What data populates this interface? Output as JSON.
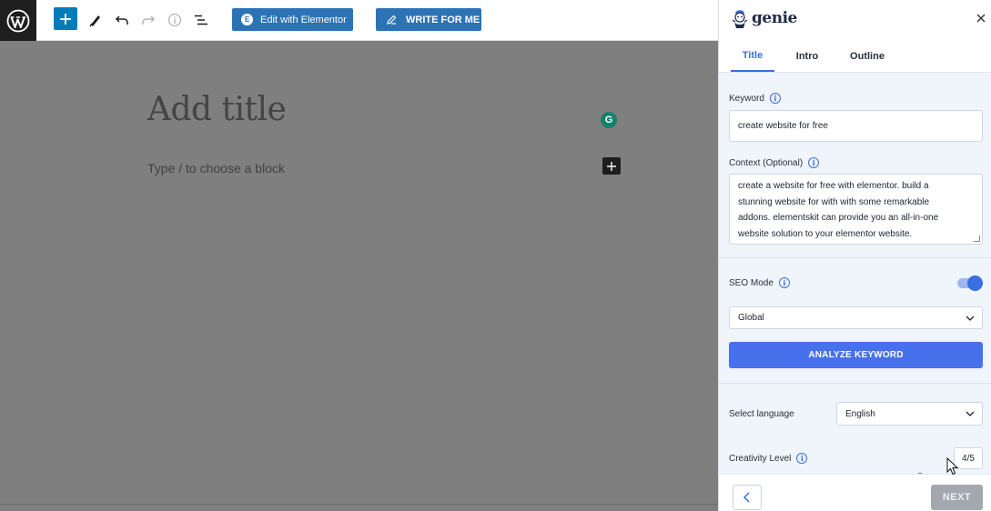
{
  "toolbar": {
    "elementor_label": "Edit with Elementor",
    "write_label": "WRITE FOR ME",
    "icons": [
      "wordpress-logo",
      "add-block-icon",
      "pen-tool-icon",
      "undo-icon",
      "redo-icon",
      "info-icon",
      "list-view-icon"
    ]
  },
  "editor": {
    "title_placeholder": "Add title",
    "block_placeholder": "Type / to choose a block"
  },
  "genie": {
    "brand": "genie",
    "tabs": [
      "Title",
      "Intro",
      "Outline"
    ],
    "active_tab": "Title",
    "keyword": {
      "label": "Keyword",
      "value": "create website for free"
    },
    "context": {
      "label": "Context (Optional)",
      "lines": [
        "create a website for free with elementor. build a",
        "stunning website for with with some remarkable",
        "addons. elementskit can provide you an all-in-one",
        "website solution to your elementor website."
      ]
    },
    "seo_mode": {
      "label": "SEO Mode",
      "enabled": true,
      "selected": "Global"
    },
    "analyze_label": "ANALYZE KEYWORD",
    "language": {
      "label": "Select language",
      "selected": "English"
    },
    "creativity": {
      "label": "Creativity Level",
      "value_text": "4/5"
    },
    "footer": {
      "next_label": "NEXT"
    }
  },
  "colors": {
    "wp_blue": "#007cba",
    "elementor_blue": "#2c73b6",
    "genie_accent": "#3b6fe0",
    "canvas_overlay": "#7f7f7f",
    "next_disabled": "#a3a8ae"
  }
}
